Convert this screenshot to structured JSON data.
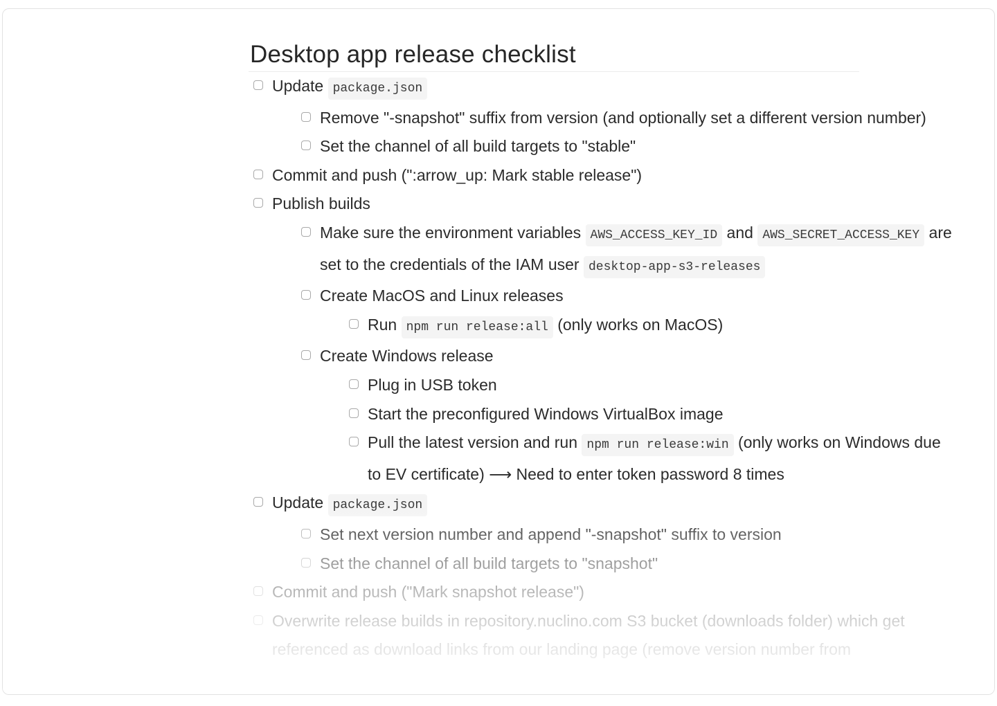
{
  "document": {
    "title": "Desktop app release checklist",
    "items": [
      {
        "parts": [
          "Update ",
          {
            "code": "package.json"
          }
        ],
        "children": [
          {
            "parts": [
              "Remove \"-snapshot\" suffix from version (and optionally set a different version number)"
            ]
          },
          {
            "parts": [
              "Set the channel of all build targets to \"stable\""
            ]
          }
        ]
      },
      {
        "parts": [
          "Commit and push (\":arrow_up: Mark stable release\")"
        ]
      },
      {
        "parts": [
          "Publish builds"
        ],
        "children": [
          {
            "parts": [
              "Make sure the environment variables ",
              {
                "code": "AWS_ACCESS_KEY_ID"
              },
              " and ",
              {
                "code": "AWS_SECRET_ACCESS_KEY"
              },
              " are set to the credentials of the IAM user ",
              {
                "code": "desktop-app-s3-releases"
              }
            ]
          },
          {
            "parts": [
              "Create MacOS and Linux releases"
            ],
            "children": [
              {
                "parts": [
                  "Run ",
                  {
                    "code": "npm run release:all"
                  },
                  " (only works on MacOS)"
                ]
              }
            ]
          },
          {
            "parts": [
              "Create Windows release"
            ],
            "children": [
              {
                "parts": [
                  "Plug in USB token"
                ]
              },
              {
                "parts": [
                  "Start the preconfigured Windows VirtualBox image"
                ]
              },
              {
                "parts": [
                  "Pull the latest version and run ",
                  {
                    "code": "npm run release:win"
                  },
                  " (only works on Windows due to EV certificate) ⟶ Need to enter token password 8 times"
                ]
              }
            ]
          }
        ]
      },
      {
        "parts": [
          "Update ",
          {
            "code": "package.json"
          }
        ],
        "children": [
          {
            "parts": [
              "Set next version number and append \"-snapshot\" suffix to version"
            ]
          },
          {
            "parts": [
              "Set the channel of all build targets to \"snapshot\""
            ]
          }
        ]
      },
      {
        "parts": [
          "Commit and push (\"Mark snapshot release\")"
        ]
      },
      {
        "parts": [
          "Overwrite release builds in repository.nuclino.com S3 bucket (downloads folder) which get referenced as download links from our landing page (remove version number from"
        ]
      }
    ]
  },
  "icons": {
    "checkbox": "checkbox-unchecked-icon"
  }
}
